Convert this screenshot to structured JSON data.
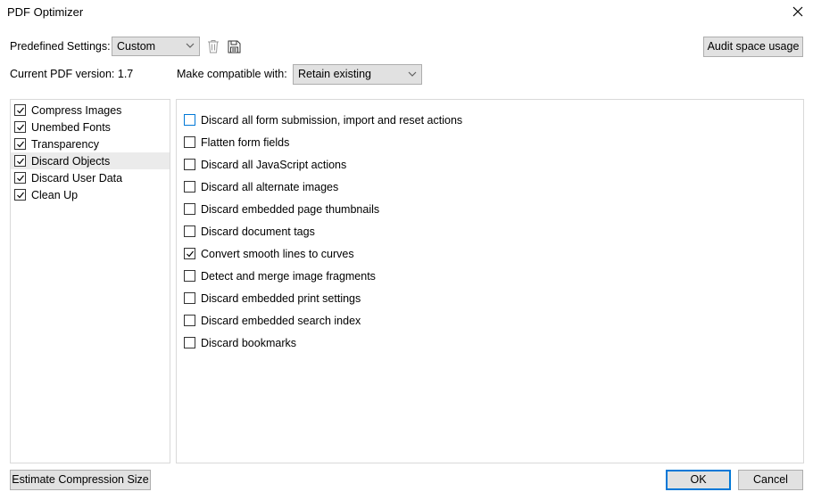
{
  "window": {
    "title": "PDF Optimizer"
  },
  "predefined": {
    "label": "Predefined Settings:",
    "value": "Custom"
  },
  "version": {
    "label": "Current PDF version: 1.7"
  },
  "compat": {
    "label": "Make compatible with:",
    "value": "Retain existing"
  },
  "buttons": {
    "audit": "Audit space usage",
    "estimate": "Estimate Compression Size",
    "ok": "OK",
    "cancel": "Cancel"
  },
  "categories": [
    {
      "label": "Compress Images",
      "checked": true
    },
    {
      "label": "Unembed Fonts",
      "checked": true
    },
    {
      "label": "Transparency",
      "checked": true
    },
    {
      "label": "Discard Objects",
      "checked": true,
      "selected": true
    },
    {
      "label": "Discard User Data",
      "checked": true
    },
    {
      "label": "Clean Up",
      "checked": true
    }
  ],
  "options": [
    {
      "label": "Discard all form submission, import and reset actions",
      "checked": false,
      "focused": true
    },
    {
      "label": "Flatten form fields",
      "checked": false
    },
    {
      "label": "Discard all JavaScript actions",
      "checked": false
    },
    {
      "label": "Discard all alternate images",
      "checked": false
    },
    {
      "label": "Discard embedded page thumbnails",
      "checked": false
    },
    {
      "label": "Discard document tags",
      "checked": false
    },
    {
      "label": "Convert smooth lines to curves",
      "checked": true
    },
    {
      "label": "Detect and merge image fragments",
      "checked": false
    },
    {
      "label": "Discard embedded print settings",
      "checked": false
    },
    {
      "label": "Discard embedded search index",
      "checked": false
    },
    {
      "label": "Discard bookmarks",
      "checked": false
    }
  ],
  "colors": {
    "accent": "#0078d7",
    "button_face": "#e1e1e1",
    "border": "#adadad"
  },
  "icons": {
    "close": "close-icon",
    "delete": "trash-icon",
    "save": "save-icon",
    "dropdown": "chevron-down-icon",
    "check": "checkmark-icon"
  }
}
